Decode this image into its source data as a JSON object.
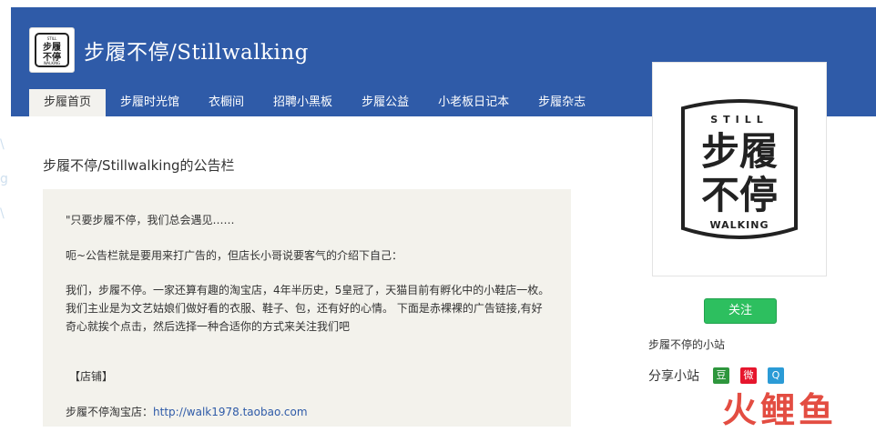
{
  "header": {
    "site_title": "步履不停/Stillwalking",
    "logo_text_top": "步履",
    "logo_text_bottom": "不停",
    "logo_small_top": "STILL",
    "logo_small_bottom": "WALKING"
  },
  "nav": {
    "items": [
      {
        "label": "步履首页"
      },
      {
        "label": "步履时光馆"
      },
      {
        "label": "衣橱间"
      },
      {
        "label": "招聘小黑板"
      },
      {
        "label": "步履公益"
      },
      {
        "label": "小老板日记本"
      },
      {
        "label": "步履杂志"
      }
    ]
  },
  "board": {
    "title": "步履不停/Stillwalking的公告栏",
    "p1": "\"只要步履不停，我们总会遇见……",
    "p2": "呃~公告栏就是要用来打广告的，但店长小哥说要客气的介绍下自己：",
    "p3": "我们，步履不停。一家还算有趣的淘宝店，4年半历史，5皇冠了，天猫目前有孵化中的小鞋店一枚。我们主业是为文艺姑娘们做好看的衣服、鞋子、包，还有好的心情。 下面是赤裸裸的广告链接,有好奇心就挨个点击，然后选择一种合适你的方式来关注我们吧",
    "p4": "【店铺】",
    "p5_label": "步履不停淘宝店：",
    "p5_link": "http://walk1978.taobao.com"
  },
  "sidebar": {
    "logo_still": "STILL",
    "logo_line1": "步履",
    "logo_line2": "不停",
    "logo_walking": "WALKING",
    "follow_label": "关注",
    "site_link": "步履不停的小站",
    "share_label": "分享小站",
    "share_icons": [
      {
        "name": "douban-icon",
        "glyph": "豆",
        "color": "#2e963d"
      },
      {
        "name": "weibo-icon",
        "glyph": "微",
        "color": "#e6162d"
      },
      {
        "name": "qzone-icon",
        "glyph": "Q",
        "color": "#2b9bd6"
      }
    ]
  },
  "watermark": "火鲤鱼",
  "left_deco": [
    "\\",
    "g",
    "\\"
  ]
}
